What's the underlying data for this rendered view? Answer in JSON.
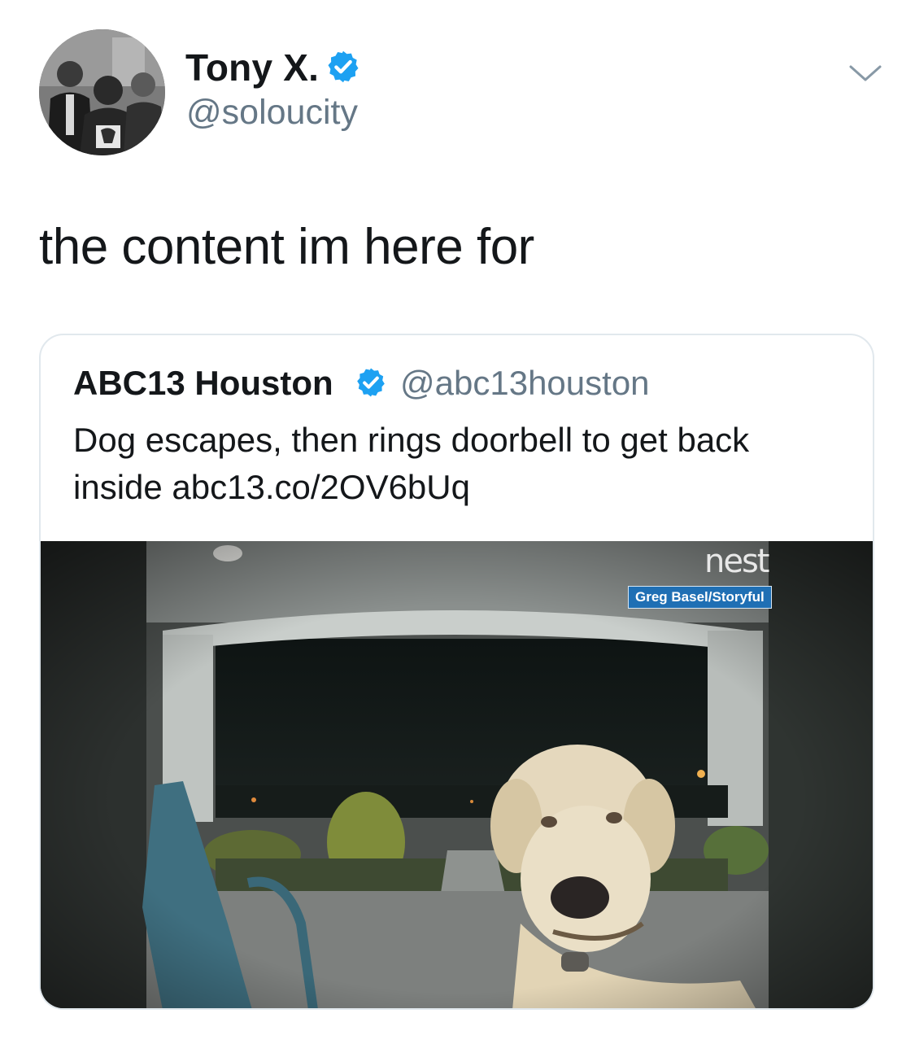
{
  "author": {
    "display_name": "Tony X.",
    "handle": "@soloucity",
    "verified": true,
    "avatar_icon": "profile-photo"
  },
  "menu_icon": "chevron-down-icon",
  "tweet": {
    "text": "the content im here for"
  },
  "quoted_tweet": {
    "display_name": "ABC13 Houston",
    "handle": "@abc13houston",
    "verified": true,
    "text": "Dog escapes, then rings doorbell to get back inside abc13.co/2OV6bUq",
    "media": {
      "watermark": "nest",
      "credit": "Greg Basel/Storyful"
    }
  },
  "colors": {
    "verified_blue": "#1da1f2",
    "secondary_text": "#657786",
    "primary_text": "#14171a",
    "border": "#e1e8ed",
    "credit_bg": "#1f6fb4"
  }
}
